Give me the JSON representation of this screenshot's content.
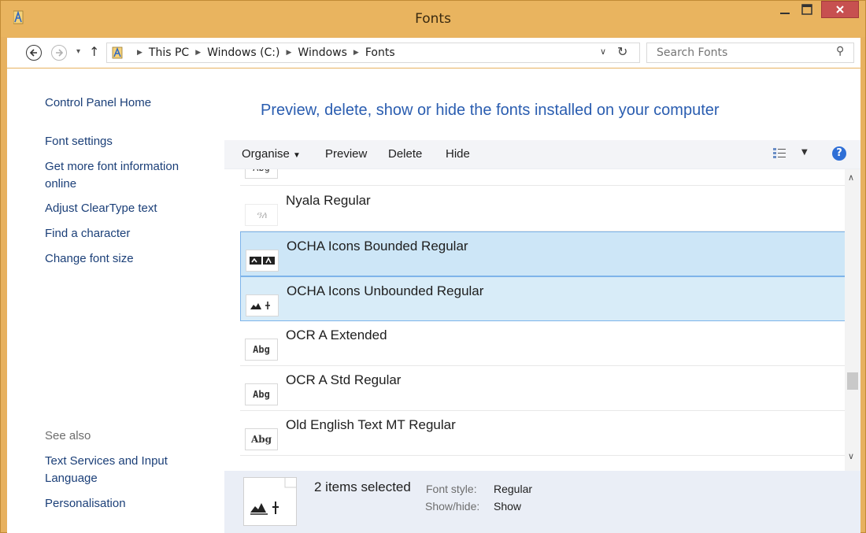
{
  "window": {
    "title": "Fonts",
    "accent_color": "#e9b45f",
    "close_color": "#c75050"
  },
  "address": {
    "breadcrumbs": [
      "This PC",
      "Windows (C:)",
      "Windows",
      "Fonts"
    ],
    "search_placeholder": "Search Fonts"
  },
  "sidebar": {
    "home": "Control Panel Home",
    "links": [
      "Font settings",
      "Get more font information online",
      "Adjust ClearType text",
      "Find a character",
      "Change font size"
    ],
    "see_also_heading": "See also",
    "see_also": [
      "Text Services and Input Language",
      "Personalisation"
    ]
  },
  "main": {
    "headline": "Preview, delete, show or hide the fonts installed on your computer",
    "toolbar": {
      "organise": "Organise",
      "preview": "Preview",
      "delete": "Delete",
      "hide": "Hide",
      "help": "?"
    },
    "fonts": [
      {
        "name": "Nyala Regular",
        "sample": "ዓለ",
        "selected": false
      },
      {
        "name": "OCHA Icons Bounded Regular",
        "sample": "",
        "selected": true
      },
      {
        "name": "OCHA Icons Unbounded Regular",
        "sample": "",
        "selected": true
      },
      {
        "name": "OCR A Extended",
        "sample": "Abg",
        "selected": false
      },
      {
        "name": "OCR A Std Regular",
        "sample": "Abg",
        "selected": false
      },
      {
        "name": "Old English Text MT Regular",
        "sample": "Abg",
        "selected": false
      }
    ]
  },
  "details": {
    "count": "2 items selected",
    "font_style_label": "Font style:",
    "font_style_value": "Regular",
    "show_hide_label": "Show/hide:",
    "show_hide_value": "Show"
  }
}
